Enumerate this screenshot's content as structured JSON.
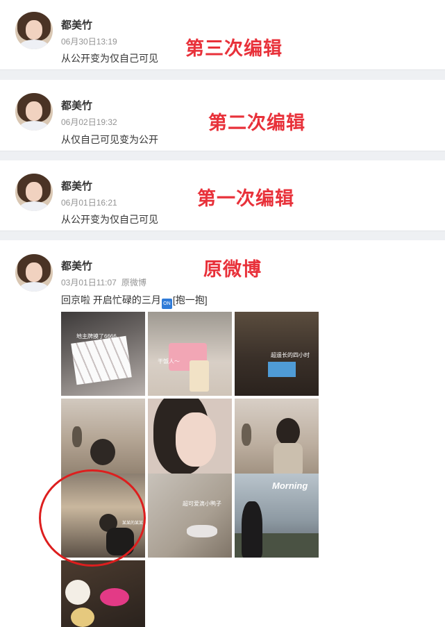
{
  "posts": [
    {
      "username": "都美竹",
      "timestamp": "06月30日13:19",
      "text": "从公开变为仅自己可见",
      "annotation": "第三次编辑"
    },
    {
      "username": "都美竹",
      "timestamp": "06月02日19:32",
      "text": "从仅自己可见变为公开",
      "annotation": "第二次编辑"
    },
    {
      "username": "都美竹",
      "timestamp": "06月01日16:21",
      "text": "从公开变为仅自己可见",
      "annotation": "第一次编辑"
    },
    {
      "username": "都美竹",
      "timestamp": "03月01日11:07",
      "source": "原微博",
      "text_before": "回京啦 开启忙碌的三月",
      "emoji_text": "ON",
      "text_after": "[抱一抱]",
      "annotation": "原微博"
    }
  ],
  "photo_captions": {
    "p1": "地主牌摸了6666",
    "p2": "干饭人～",
    "p3": "超遥长的四小时",
    "p7": "某某的某某",
    "p8": "超可爱滴小鸭子",
    "p9": "Morning"
  },
  "colors": {
    "annotation": "#e8313a",
    "circle": "#dd1e1e",
    "meta": "#939393",
    "emoji_bg": "#2f7bd8"
  }
}
